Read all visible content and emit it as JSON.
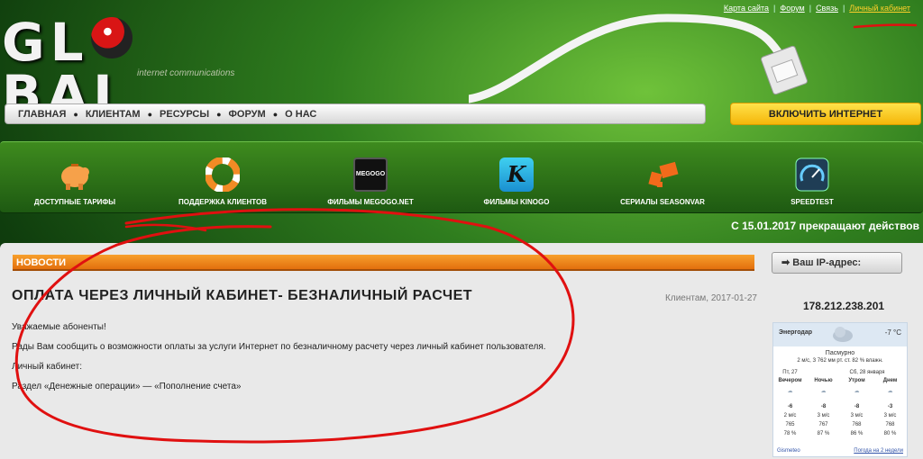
{
  "top_links": {
    "sitemap": "Карта сайта",
    "forum": "Форум",
    "contact": "Связь",
    "cabinet": "Личный кабинет"
  },
  "logo": {
    "text_left": "GL",
    "text_right": "BAL",
    "subtitle": "internet communications"
  },
  "nav": {
    "items": [
      "ГЛАВНАЯ",
      "КЛИЕНТАМ",
      "РЕСУРСЫ",
      "ФОРУМ",
      "О НАС"
    ]
  },
  "connect_button": "ВКЛЮЧИТЬ ИНТЕРНЕТ",
  "services": [
    {
      "label": "ДОСТУПНЫЕ ТАРИФЫ",
      "icon": "piggy-bank-icon"
    },
    {
      "label": "ПОДДЕРЖКА КЛИЕНТОВ",
      "icon": "lifebuoy-icon"
    },
    {
      "label": "ФИЛЬМЫ MEGOGO.NET",
      "icon": "megogo-icon",
      "badge": "MEGOGO"
    },
    {
      "label": "ФИЛЬМЫ KINOGO",
      "icon": "kinogo-icon",
      "badge": "K"
    },
    {
      "label": "СЕРИАЛЫ SEASONVAR",
      "icon": "seasonvar-icon"
    },
    {
      "label": "SPEEDTEST",
      "icon": "speedometer-icon"
    }
  ],
  "ticker": "С 15.01.2017 прекращают действов",
  "news": {
    "header": "НОВОСТИ",
    "title": "ОПЛАТА ЧЕРЕЗ ЛИЧНЫЙ КАБИНЕТ- БЕЗНАЛИЧНЫЙ РАСЧЕТ",
    "meta": "Клиентам, 2017-01-27",
    "paragraphs": [
      "Уважаемые абоненты!",
      "Рады Вам сообщить о  возможности оплаты за услуги Интернет по безналичному расчету через личный кабинет пользователя.",
      "Личный кабинет:",
      "Раздел «Денежные операции» — «Пополнение счета»"
    ]
  },
  "sidebar": {
    "ip_header": "Ваш IP-адрес:",
    "ip_value": "178.212.238.201"
  },
  "weather": {
    "city": "Энергодар",
    "temp": "-7 °C",
    "condition": "Пасмурно",
    "details": "2 м/с, З  762 мм рт. ст.  82 % влажн.",
    "date_left": "Пт, 27",
    "date_right": "Сб, 28 января",
    "periods": [
      "Вечером",
      "Ночью",
      "Утром",
      "Днем"
    ],
    "temps": [
      "-6",
      "-8",
      "-8",
      "-3"
    ],
    "winds": [
      "2 м/с",
      "3 м/с",
      "3 м/с",
      "3 м/с"
    ],
    "pressure": [
      "765",
      "767",
      "768",
      "768"
    ],
    "humidity": [
      "78 %",
      "87 %",
      "86 %",
      "80 %"
    ],
    "brand": "Gismeteo",
    "forecast_link": "Погода на 2 недели"
  },
  "colors": {
    "accent": "#e36f0d",
    "brand_green": "#2f7d1e",
    "button_yellow": "#f5b60a",
    "annotation_red": "#e01010"
  }
}
